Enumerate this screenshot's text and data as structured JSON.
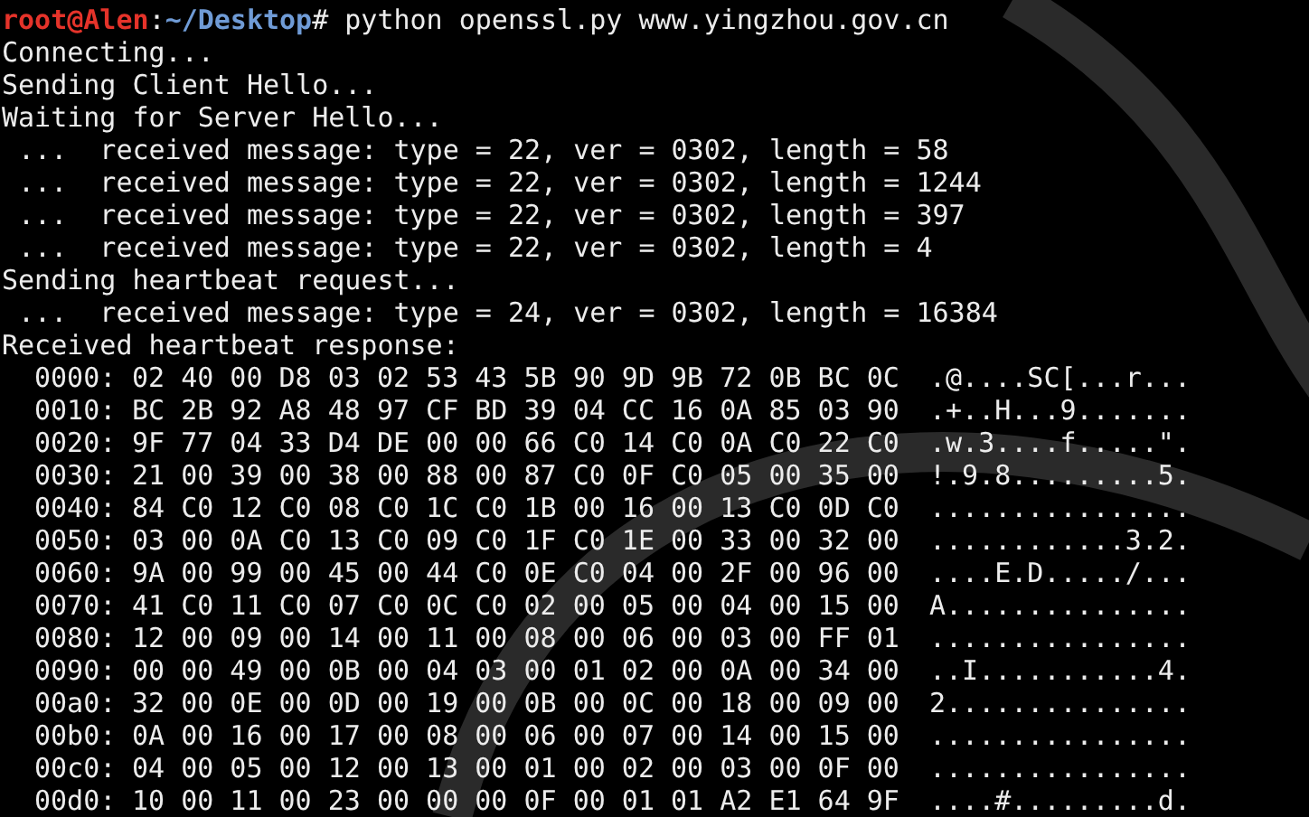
{
  "prompt": {
    "user": "root@Alen",
    "separator": ":",
    "path": "~/Desktop",
    "symbol": "#",
    "command": "python openssl.py www.yingzhou.gov.cn"
  },
  "output": [
    "Connecting...",
    "Sending Client Hello...",
    "Waiting for Server Hello...",
    " ...  received message: type = 22, ver = 0302, length = 58",
    " ...  received message: type = 22, ver = 0302, length = 1244",
    " ...  received message: type = 22, ver = 0302, length = 397",
    " ...  received message: type = 22, ver = 0302, length = 4",
    "Sending heartbeat request...",
    " ...  received message: type = 24, ver = 0302, length = 16384",
    "Received heartbeat response:"
  ],
  "hex_dump": [
    {
      "offset": "0000:",
      "bytes": "02 40 00 D8 03 02 53 43 5B 90 9D 9B 72 0B BC 0C",
      "ascii": ".@....SC[...r..."
    },
    {
      "offset": "0010:",
      "bytes": "BC 2B 92 A8 48 97 CF BD 39 04 CC 16 0A 85 03 90",
      "ascii": ".+..H...9......."
    },
    {
      "offset": "0020:",
      "bytes": "9F 77 04 33 D4 DE 00 00 66 C0 14 C0 0A C0 22 C0",
      "ascii": ".w.3....f.....\"."
    },
    {
      "offset": "0030:",
      "bytes": "21 00 39 00 38 00 88 00 87 C0 0F C0 05 00 35 00",
      "ascii": "!.9.8.........5."
    },
    {
      "offset": "0040:",
      "bytes": "84 C0 12 C0 08 C0 1C C0 1B 00 16 00 13 C0 0D C0",
      "ascii": "................"
    },
    {
      "offset": "0050:",
      "bytes": "03 00 0A C0 13 C0 09 C0 1F C0 1E 00 33 00 32 00",
      "ascii": "............3.2."
    },
    {
      "offset": "0060:",
      "bytes": "9A 00 99 00 45 00 44 C0 0E C0 04 00 2F 00 96 00",
      "ascii": "....E.D...../..."
    },
    {
      "offset": "0070:",
      "bytes": "41 C0 11 C0 07 C0 0C C0 02 00 05 00 04 00 15 00",
      "ascii": "A..............."
    },
    {
      "offset": "0080:",
      "bytes": "12 00 09 00 14 00 11 00 08 00 06 00 03 00 FF 01",
      "ascii": "................"
    },
    {
      "offset": "0090:",
      "bytes": "00 00 49 00 0B 00 04 03 00 01 02 00 0A 00 34 00",
      "ascii": "..I...........4."
    },
    {
      "offset": "00a0:",
      "bytes": "32 00 0E 00 0D 00 19 00 0B 00 0C 00 18 00 09 00",
      "ascii": "2..............."
    },
    {
      "offset": "00b0:",
      "bytes": "0A 00 16 00 17 00 08 00 06 00 07 00 14 00 15 00",
      "ascii": "................"
    },
    {
      "offset": "00c0:",
      "bytes": "04 00 05 00 12 00 13 00 01 00 02 00 03 00 0F 00",
      "ascii": "................"
    },
    {
      "offset": "00d0:",
      "bytes": "10 00 11 00 23 00 00 00 0F 00 01 01 A2 E1 64 9F",
      "ascii": "....#.........d."
    }
  ]
}
